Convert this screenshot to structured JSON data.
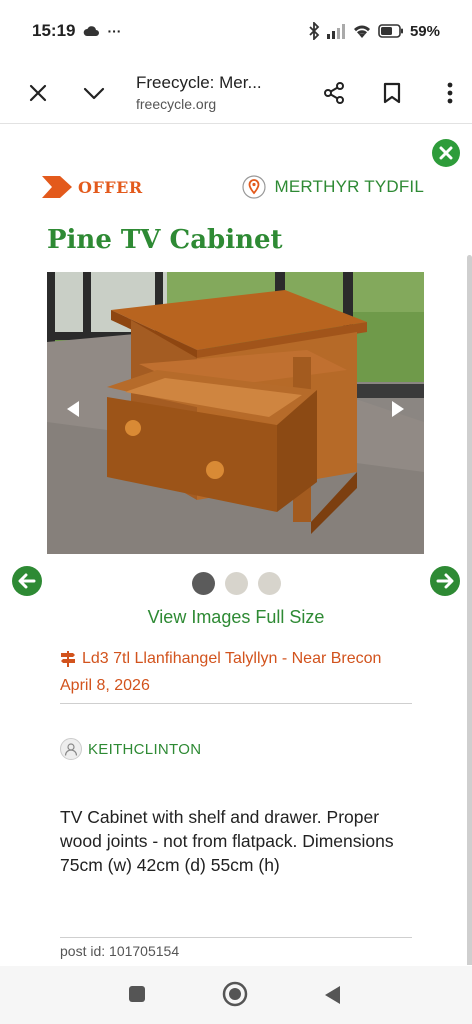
{
  "status_bar": {
    "time": "15:19",
    "notification_dots": "···",
    "battery_percent": "59%"
  },
  "browser": {
    "page_title": "Freecycle: Mer...",
    "url": "freecycle.org"
  },
  "listing": {
    "type_label": "OFFER",
    "location": "MERTHYR TYDFIL",
    "title": "Pine TV Cabinet",
    "image_count": 3,
    "active_image_index": 0,
    "view_full_size": "View Images Full Size",
    "pickup_location": "Ld3 7tl Llanfihangel Talyllyn - Near Brecon",
    "date": "April 8, 2026",
    "username": "KEITHCLINTON",
    "description": "TV Cabinet with shelf and drawer. Proper wood joints - not from flatpack. Dimensions 75cm (w) 42cm (d) 55cm (h)",
    "post_id": "post id: 101705154"
  },
  "colors": {
    "brand_green": "#2e8a34",
    "offer_orange": "#e35a1c",
    "meta_orange": "#d2531d"
  },
  "icons": {
    "close": "close-icon",
    "collapse": "chevron-down-icon",
    "share": "share-icon",
    "bookmark": "bookmark-icon",
    "more": "more-vert-icon",
    "location_pin": "location-pin-icon",
    "signpost": "signpost-icon",
    "user": "user-avatar-icon"
  }
}
